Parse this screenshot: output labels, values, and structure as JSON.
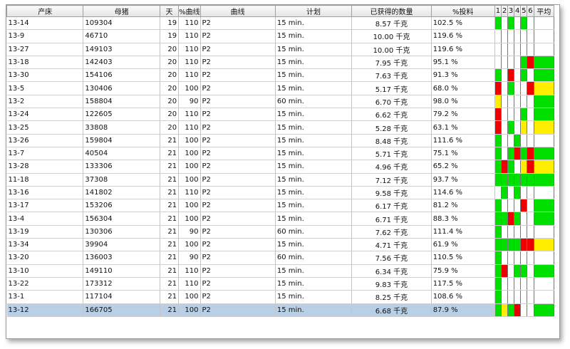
{
  "headers": [
    "产床",
    "母猪",
    "天",
    "%曲线",
    "曲线",
    "计划",
    "已获得的数量",
    "%投料",
    "1",
    "2",
    "3",
    "4",
    "5",
    "6",
    "平均"
  ],
  "colors": {
    "G": "#00e000",
    "R": "#ee0000",
    "Y": "#ffee00",
    "W": "#ffffff"
  },
  "rows": [
    {
      "bed": "13-14",
      "sow": "109304",
      "day": "19",
      "pct": "110",
      "curve": "P2",
      "plan": "15 min.",
      "qty": "8.57 千克",
      "feed": "102.5 %",
      "d": [
        "G",
        "W",
        "G",
        "W",
        "G",
        "W"
      ],
      "avg": "W"
    },
    {
      "bed": "13-9",
      "sow": "46710",
      "day": "19",
      "pct": "110",
      "curve": "P2",
      "plan": "15 min.",
      "qty": "10.00 千克",
      "feed": "119.6 %",
      "d": [
        "W",
        "W",
        "W",
        "W",
        "W",
        "W"
      ],
      "avg": "W"
    },
    {
      "bed": "13-27",
      "sow": "149103",
      "day": "20",
      "pct": "110",
      "curve": "P2",
      "plan": "15 min.",
      "qty": "10.00 千克",
      "feed": "119.6 %",
      "d": [
        "W",
        "W",
        "W",
        "W",
        "W",
        "W"
      ],
      "avg": "W"
    },
    {
      "bed": "13-18",
      "sow": "142403",
      "day": "20",
      "pct": "110",
      "curve": "P2",
      "plan": "15 min.",
      "qty": "7.95 千克",
      "feed": "95.1 %",
      "d": [
        "W",
        "W",
        "W",
        "W",
        "G",
        "R"
      ],
      "avg": "G"
    },
    {
      "bed": "13-30",
      "sow": "154106",
      "day": "20",
      "pct": "110",
      "curve": "P2",
      "plan": "15 min.",
      "qty": "7.63 千克",
      "feed": "91.3 %",
      "d": [
        "G",
        "W",
        "R",
        "W",
        "G",
        "W"
      ],
      "avg": "G"
    },
    {
      "bed": "13-5",
      "sow": "130406",
      "day": "20",
      "pct": "100",
      "curve": "P2",
      "plan": "15 min.",
      "qty": "5.17 千克",
      "feed": "68.0 %",
      "d": [
        "R",
        "W",
        "G",
        "W",
        "W",
        "R"
      ],
      "avg": "Y"
    },
    {
      "bed": "13-2",
      "sow": "158804",
      "day": "20",
      "pct": "90",
      "curve": "P2",
      "plan": "60 min.",
      "qty": "6.70 千克",
      "feed": "98.0 %",
      "d": [
        "Y",
        "W",
        "W",
        "W",
        "W",
        "W"
      ],
      "avg": "G"
    },
    {
      "bed": "13-24",
      "sow": "122605",
      "day": "20",
      "pct": "110",
      "curve": "P2",
      "plan": "15 min.",
      "qty": "6.62 千克",
      "feed": "79.2 %",
      "d": [
        "R",
        "W",
        "W",
        "W",
        "G",
        "W"
      ],
      "avg": "G"
    },
    {
      "bed": "13-25",
      "sow": "33808",
      "day": "20",
      "pct": "110",
      "curve": "P2",
      "plan": "15 min.",
      "qty": "5.28 千克",
      "feed": "63.1 %",
      "d": [
        "R",
        "W",
        "G",
        "W",
        "Y",
        "W"
      ],
      "avg": "Y"
    },
    {
      "bed": "13-26",
      "sow": "159804",
      "day": "21",
      "pct": "100",
      "curve": "P2",
      "plan": "15 min.",
      "qty": "8.48 千克",
      "feed": "111.6 %",
      "d": [
        "G",
        "W",
        "W",
        "G",
        "W",
        "W"
      ],
      "avg": "W"
    },
    {
      "bed": "13-7",
      "sow": "40504",
      "day": "21",
      "pct": "100",
      "curve": "P2",
      "plan": "15 min.",
      "qty": "5.71 千克",
      "feed": "75.1 %",
      "d": [
        "G",
        "W",
        "G",
        "R",
        "G",
        "R"
      ],
      "avg": "G"
    },
    {
      "bed": "13-28",
      "sow": "133306",
      "day": "21",
      "pct": "100",
      "curve": "P2",
      "plan": "15 min.",
      "qty": "4.96 千克",
      "feed": "65.2 %",
      "d": [
        "G",
        "R",
        "G",
        "W",
        "Y",
        "R"
      ],
      "avg": "Y"
    },
    {
      "bed": "11-18",
      "sow": "37308",
      "day": "21",
      "pct": "100",
      "curve": "P2",
      "plan": "15 min.",
      "qty": "7.12 千克",
      "feed": "93.7 %",
      "d": [
        "G",
        "G",
        "G",
        "G",
        "G",
        "G"
      ],
      "avg": "G"
    },
    {
      "bed": "13-16",
      "sow": "141802",
      "day": "21",
      "pct": "110",
      "curve": "P2",
      "plan": "15 min.",
      "qty": "9.58 千克",
      "feed": "114.6 %",
      "d": [
        "W",
        "G",
        "W",
        "G",
        "W",
        "W"
      ],
      "avg": "W"
    },
    {
      "bed": "13-17",
      "sow": "153206",
      "day": "21",
      "pct": "100",
      "curve": "P2",
      "plan": "15 min.",
      "qty": "6.17 千克",
      "feed": "81.2 %",
      "d": [
        "G",
        "W",
        "W",
        "W",
        "R",
        "W"
      ],
      "avg": "G"
    },
    {
      "bed": "13-4",
      "sow": "156304",
      "day": "21",
      "pct": "100",
      "curve": "P2",
      "plan": "15 min.",
      "qty": "6.71 千克",
      "feed": "88.3 %",
      "d": [
        "G",
        "G",
        "R",
        "G",
        "W",
        "W"
      ],
      "avg": "G"
    },
    {
      "bed": "13-19",
      "sow": "130306",
      "day": "21",
      "pct": "90",
      "curve": "P2",
      "plan": "60 min.",
      "qty": "7.62 千克",
      "feed": "111.4 %",
      "d": [
        "G",
        "W",
        "W",
        "W",
        "W",
        "W"
      ],
      "avg": "W"
    },
    {
      "bed": "13-34",
      "sow": "39904",
      "day": "21",
      "pct": "100",
      "curve": "P2",
      "plan": "15 min.",
      "qty": "4.71 千克",
      "feed": "61.9 %",
      "d": [
        "G",
        "G",
        "G",
        "G",
        "R",
        "R"
      ],
      "avg": "Y"
    },
    {
      "bed": "13-20",
      "sow": "136003",
      "day": "21",
      "pct": "90",
      "curve": "P2",
      "plan": "60 min.",
      "qty": "7.56 千克",
      "feed": "110.5 %",
      "d": [
        "G",
        "W",
        "W",
        "W",
        "W",
        "W"
      ],
      "avg": "W"
    },
    {
      "bed": "13-10",
      "sow": "149110",
      "day": "21",
      "pct": "110",
      "curve": "P2",
      "plan": "15 min.",
      "qty": "6.34 千克",
      "feed": "75.9 %",
      "d": [
        "G",
        "R",
        "W",
        "G",
        "G",
        "W"
      ],
      "avg": "G"
    },
    {
      "bed": "13-22",
      "sow": "173312",
      "day": "21",
      "pct": "110",
      "curve": "P2",
      "plan": "15 min.",
      "qty": "9.83 千克",
      "feed": "117.5 %",
      "d": [
        "G",
        "W",
        "W",
        "W",
        "W",
        "W"
      ],
      "avg": "W"
    },
    {
      "bed": "13-1",
      "sow": "117104",
      "day": "21",
      "pct": "100",
      "curve": "P2",
      "plan": "15 min.",
      "qty": "8.25 千克",
      "feed": "108.6 %",
      "d": [
        "G",
        "W",
        "W",
        "W",
        "W",
        "W"
      ],
      "avg": "W"
    },
    {
      "bed": "13-12",
      "sow": "166705",
      "day": "21",
      "pct": "100",
      "curve": "P2",
      "plan": "15 min.",
      "qty": "6.68 千克",
      "feed": "87.9 %",
      "d": [
        "G",
        "Y",
        "G",
        "R",
        "W",
        "W"
      ],
      "avg": "G",
      "selected": true
    }
  ]
}
